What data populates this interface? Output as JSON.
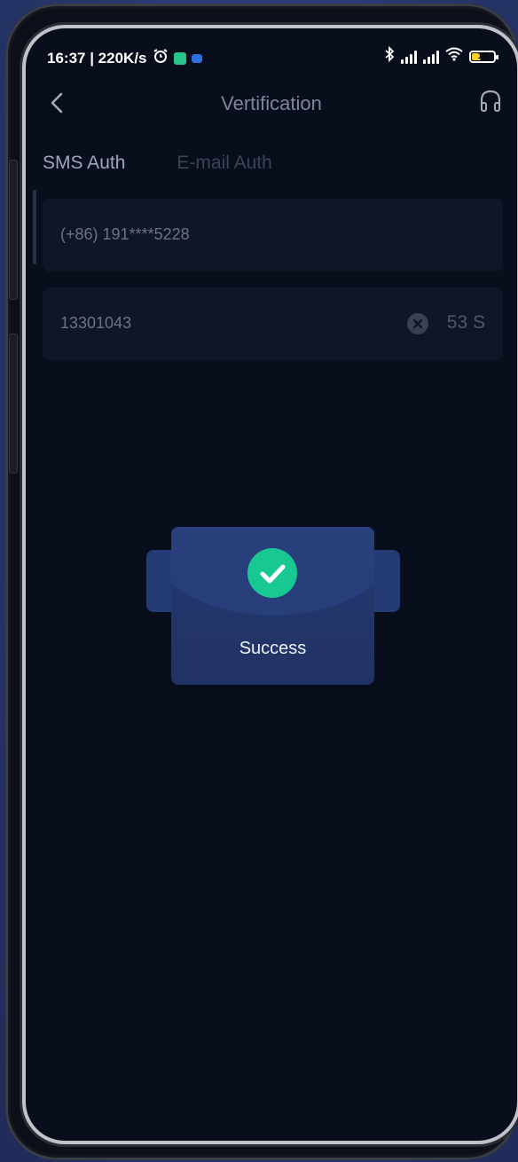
{
  "status_bar": {
    "time_speed": "16:37 | 220K/s",
    "battery_level": "17",
    "icons": [
      "alarm-icon",
      "app-icon",
      "bluetooth-icon",
      "signal-icon",
      "wifi-icon",
      "battery-icon"
    ]
  },
  "nav": {
    "title": "Vertification"
  },
  "tabs": {
    "sms_label": "SMS Auth",
    "email_label": "E-mail Auth"
  },
  "form": {
    "phone_value": "(+86) 191****5228",
    "code_value": "13301043",
    "countdown": "53 S"
  },
  "toast": {
    "label": "Success"
  },
  "colors": {
    "background": "#080e1c",
    "success": "#18c893",
    "toast": "#223569"
  }
}
